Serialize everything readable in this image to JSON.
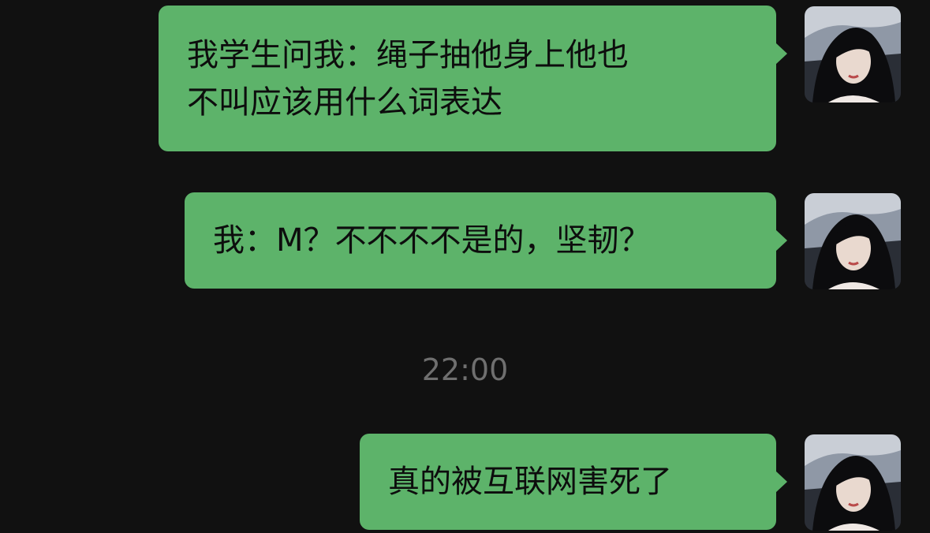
{
  "chat": {
    "messages": [
      {
        "text": "我学生问我：绳子抽他身上他也\n不叫应该用什么词表达",
        "sender": "self",
        "avatar_icon": "user-avatar-icon"
      },
      {
        "text": "我：M？不不不不是的，坚韧？",
        "sender": "self",
        "avatar_icon": "user-avatar-icon"
      },
      {
        "text": "真的被互联网害死了",
        "sender": "self",
        "avatar_icon": "user-avatar-icon"
      }
    ],
    "timestamp": "22:00"
  },
  "theme": {
    "background": "#111111",
    "bubble_color": "#5db36a",
    "timestamp_color": "#6f6f6f"
  }
}
